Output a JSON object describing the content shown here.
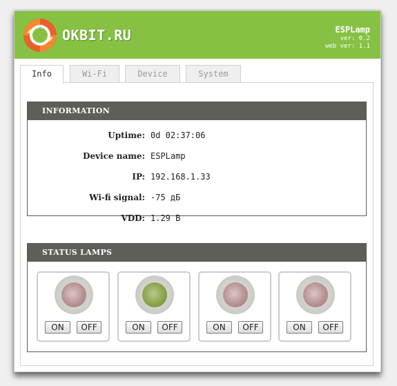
{
  "header": {
    "logo_text": "OKBIT.RU",
    "device_title": "ESPLamp",
    "ver": "ver: 0.2",
    "web_ver": "web ver: 1.1"
  },
  "tabs": [
    {
      "label": "Info",
      "active": true
    },
    {
      "label": "Wi-Fi",
      "active": false
    },
    {
      "label": "Device",
      "active": false
    },
    {
      "label": "System",
      "active": false
    }
  ],
  "information": {
    "title": "INFORMATION",
    "rows": [
      {
        "label": "Uptime:",
        "value": "0d 02:37:06"
      },
      {
        "label": "Device name:",
        "value": "ESPLamp"
      },
      {
        "label": "IP:",
        "value": "192.168.1.33"
      },
      {
        "label": "Wi-fi signal:",
        "value": "-75 дБ"
      },
      {
        "label": "VDD:",
        "value": "1.29 В"
      }
    ]
  },
  "status_lamps": {
    "title": "STATUS LAMPS",
    "lamps": [
      {
        "state": "off",
        "on_label": "ON",
        "off_label": "OFF"
      },
      {
        "state": "on",
        "on_label": "ON",
        "off_label": "OFF"
      },
      {
        "state": "off",
        "on_label": "ON",
        "off_label": "OFF"
      },
      {
        "state": "off",
        "on_label": "ON",
        "off_label": "OFF"
      }
    ]
  },
  "colors": {
    "header_green": "#86c144",
    "panel_header": "#5f5e59",
    "lamp_on": "#8aa54c",
    "lamp_off": "#b99393"
  }
}
